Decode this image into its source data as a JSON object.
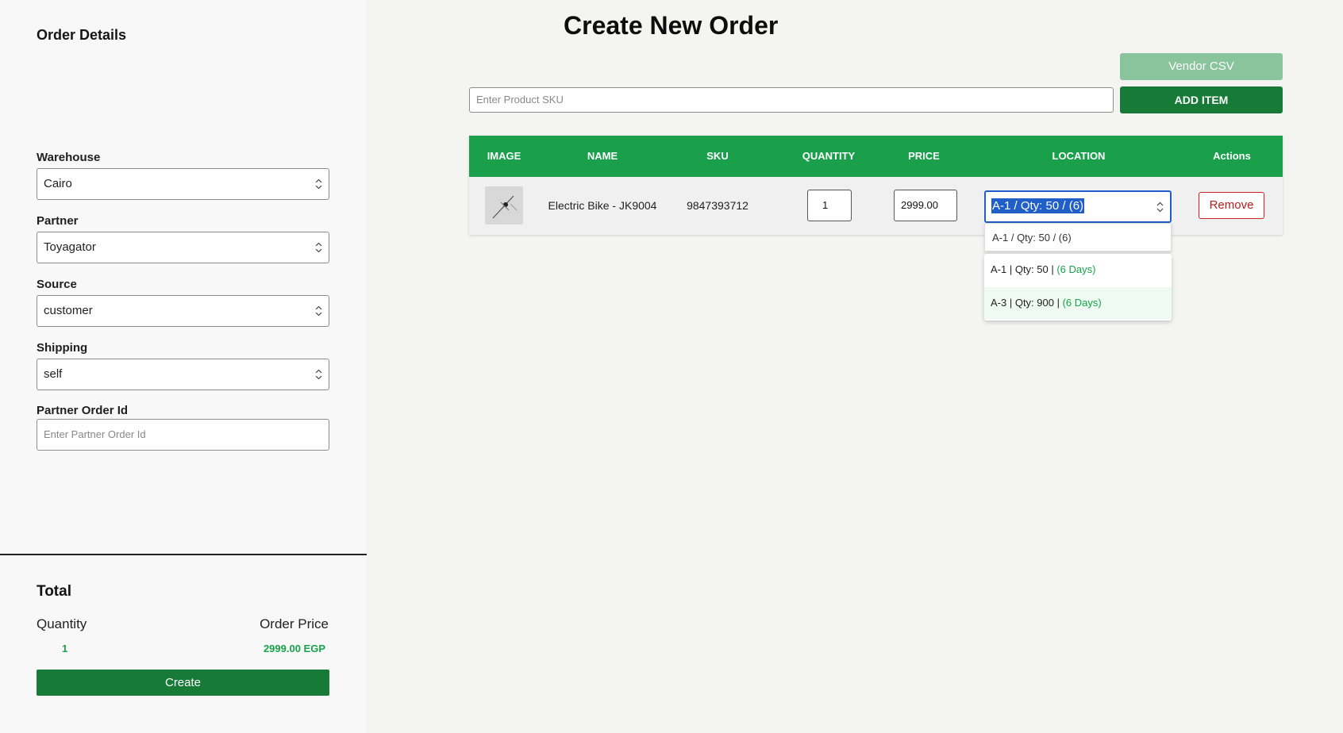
{
  "sidebar": {
    "title": "Order Details",
    "warehouse": {
      "label": "Warehouse",
      "value": "Cairo"
    },
    "partner": {
      "label": "Partner",
      "value": "Toyagator"
    },
    "source": {
      "label": "Source",
      "value": "customer"
    },
    "shipping": {
      "label": "Shipping",
      "value": "self"
    },
    "partner_order_id": {
      "label": "Partner Order Id",
      "placeholder": "Enter Partner Order Id"
    }
  },
  "total": {
    "title": "Total",
    "quantity_label": "Quantity",
    "quantity_value": "1",
    "price_label": "Order Price",
    "price_value": "2999.00 EGP",
    "create_label": "Create"
  },
  "main": {
    "title": "Create New Order",
    "vendor_csv_label": "Vendor CSV",
    "sku_placeholder": "Enter Product SKU",
    "add_item_label": "ADD ITEM"
  },
  "table": {
    "headers": [
      "IMAGE",
      "NAME",
      "SKU",
      "QUANTITY",
      "PRICE",
      "LOCATION",
      "Actions"
    ],
    "rows": [
      {
        "name": "Electric Bike - JK9004",
        "sku": "9847393712",
        "quantity": "1",
        "price": "2999.00",
        "location": "A-1 / Qty: 50 / (6)",
        "action": "Remove"
      }
    ]
  },
  "location_dropdown": {
    "current": "A-1 / Qty: 50 / (6)",
    "options": [
      {
        "prefix": "A-1 | Qty: 50 | ",
        "days": "(6 Days)"
      },
      {
        "prefix": "A-3 | Qty: 900 | ",
        "days": "(6 Days)"
      }
    ]
  },
  "colors": {
    "primary_green": "#177a36",
    "header_green": "#1aa04b",
    "accent_green": "#16a34a",
    "danger_red": "#b91c1c",
    "focus_blue": "#1f5fc7"
  }
}
